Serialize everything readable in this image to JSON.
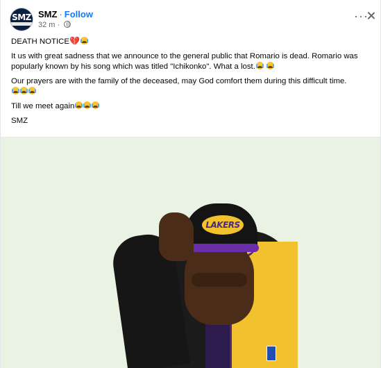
{
  "post": {
    "page_name": "SMZ",
    "separator": "·",
    "follow_label": "Follow",
    "time": "32 m",
    "dot": "·",
    "avatar_text": "SMZ",
    "more_icon": "more-horizontal-icon",
    "close_icon": "close-icon",
    "audience_icon": "globe-icon"
  },
  "body": {
    "p1_text": "DEATH NOTICE",
    "p1_emoji": "💔",
    "p2_text": "It us with great sadness that we announce to the general public that Romario is dead. Romario was popularly known by his song which was titled \"Ichikonko\". What a lost.",
    "p3_text": "Our prayers are with the family of the deceased, may God comfort them during this difficult time.",
    "p4_text": "Till we meet again",
    "p5_text": "SMZ"
  },
  "photo": {
    "cap_logo_text": "LAKERS"
  },
  "colors": {
    "link_blue": "#1877f2",
    "secondary_text": "#65676b",
    "lakers_purple": "#4b2a7e",
    "lakers_gold": "#f2c12e"
  }
}
